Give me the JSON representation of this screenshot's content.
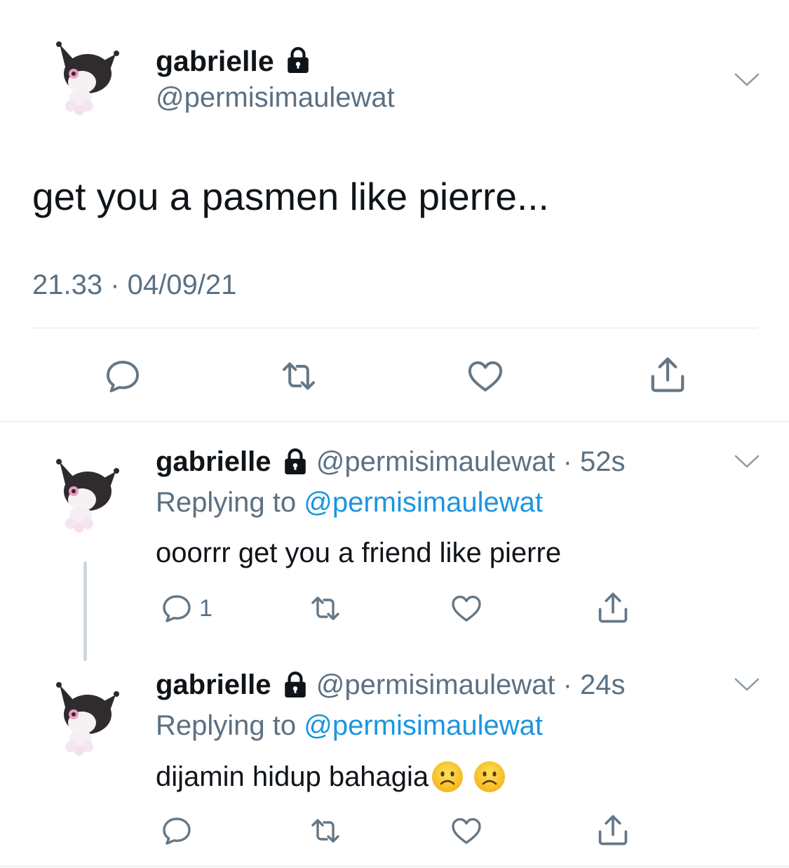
{
  "main_tweet": {
    "display_name": "gabrielle",
    "handle": "@permisimaulewat",
    "text": "get you a pasmen like pierre...",
    "timestamp": "21.33 · 04/09/21",
    "avatar_icon": "kuromi-avatar-icon",
    "lock_icon": "lock-icon",
    "actions": [
      "reply-icon",
      "retweet-icon",
      "like-icon",
      "share-icon"
    ]
  },
  "replies": [
    {
      "display_name": "gabrielle",
      "handle": "@permisimaulewat",
      "time": "52s",
      "replying_prefix": "Replying to",
      "replying_to": "@permisimaulewat",
      "text": "ooorrr get you a friend like pierre",
      "reply_count": "1"
    },
    {
      "display_name": "gabrielle",
      "handle": "@permisimaulewat",
      "time": "24s",
      "replying_prefix": "Replying to",
      "replying_to": "@permisimaulewat",
      "text": "dijamin hidup bahagia",
      "emojis": [
        "frowning-face-emoji",
        "frowning-face-emoji"
      ],
      "reply_count": ""
    }
  ],
  "colors": {
    "text": "#0f1419",
    "secondary": "#5b7083",
    "link": "#1b95e0",
    "icon": "#657786",
    "border": "#e1e5e8"
  }
}
